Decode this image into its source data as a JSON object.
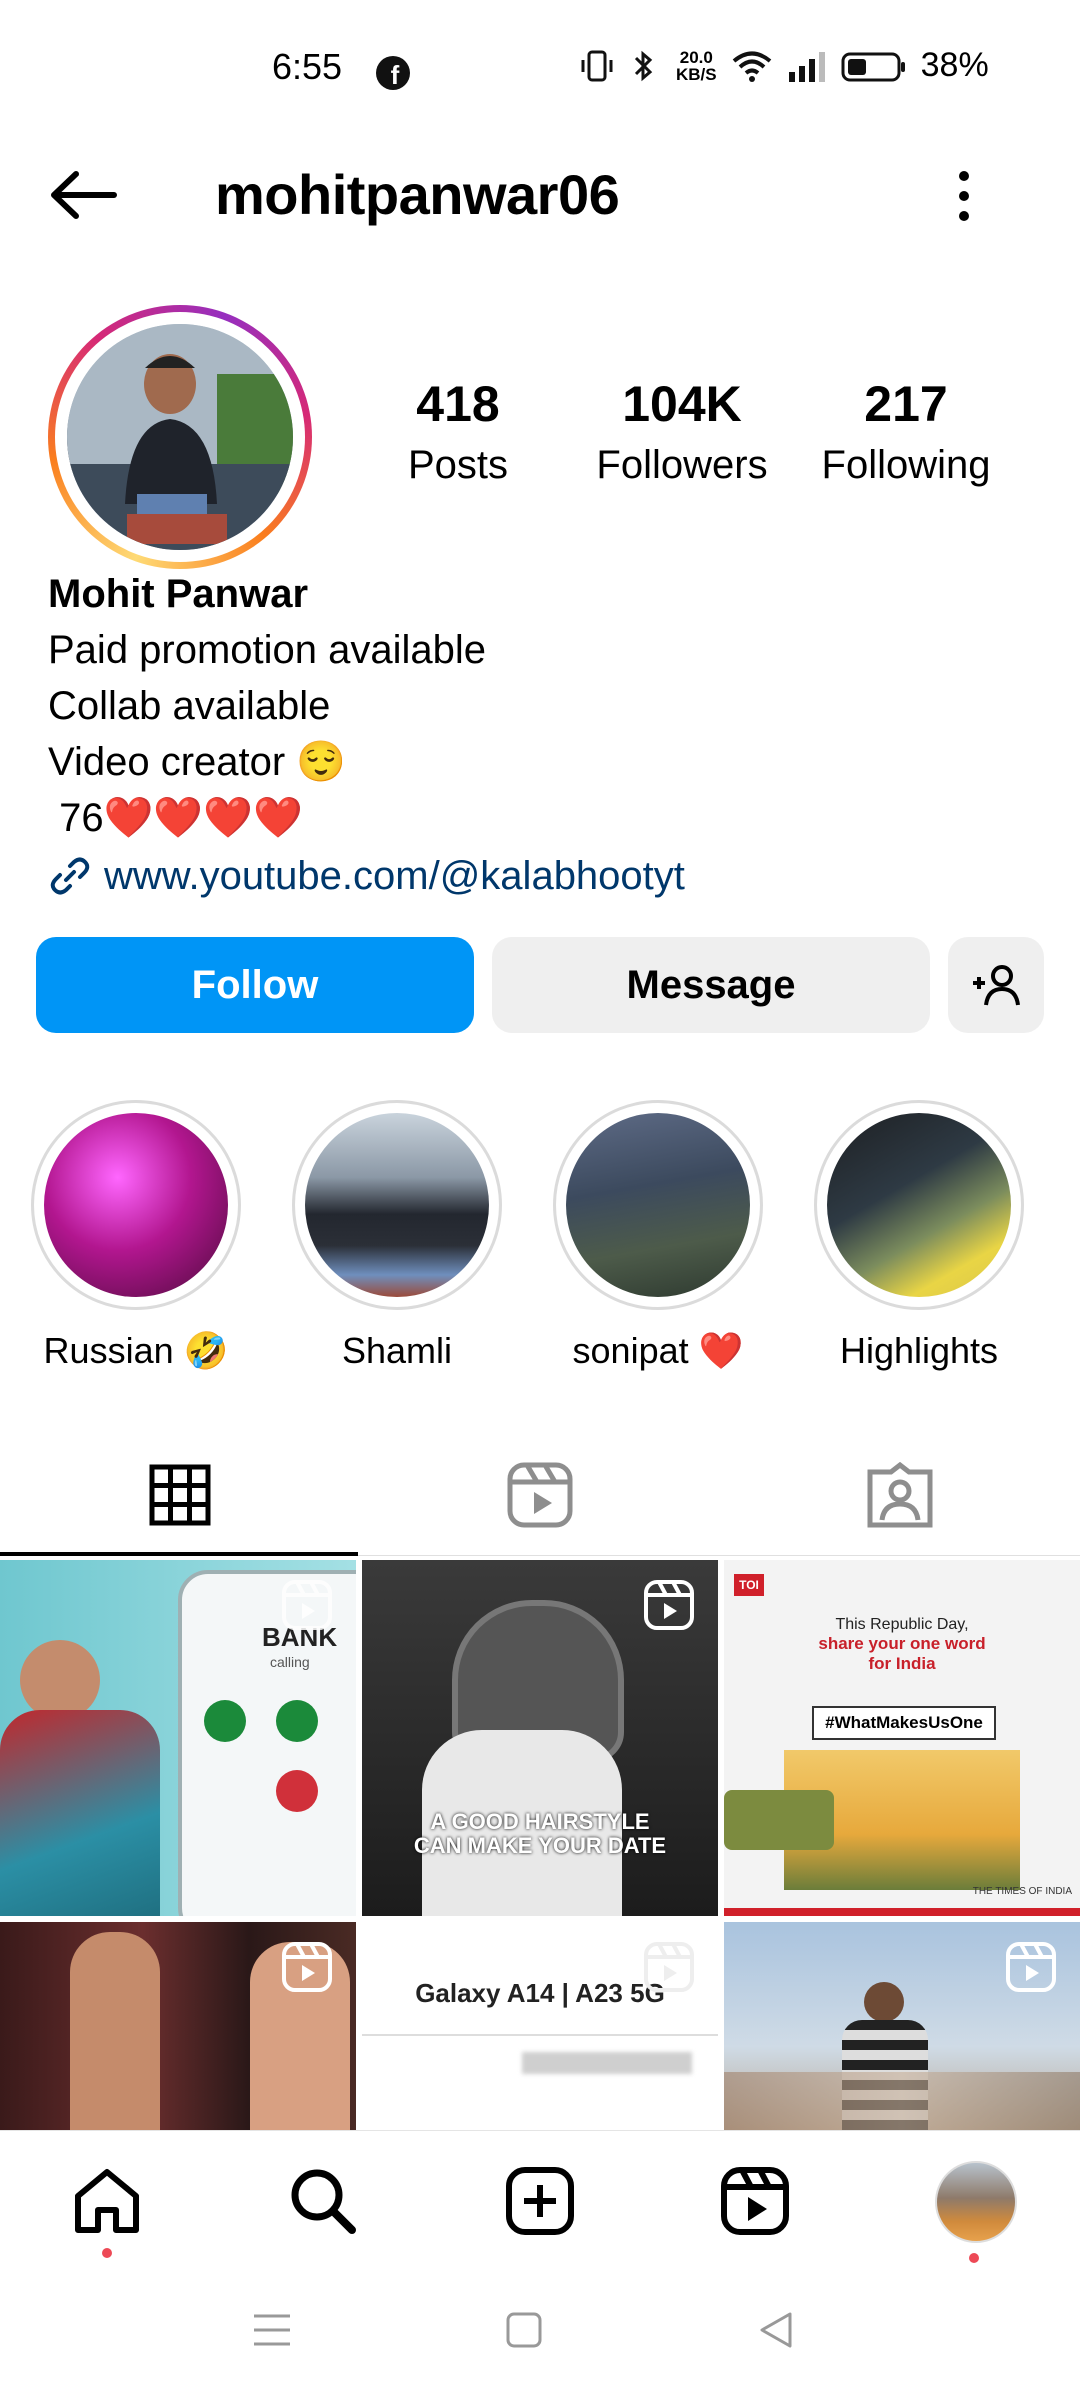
{
  "status_bar": {
    "time": "6:55",
    "speed_value": "20.0",
    "speed_unit": "KB/S",
    "battery": "38%"
  },
  "header": {
    "username": "mohitpanwar06"
  },
  "profile": {
    "stats": [
      {
        "value": "418",
        "label": "Posts"
      },
      {
        "value": "104K",
        "label": "Followers"
      },
      {
        "value": "217",
        "label": "Following"
      }
    ],
    "name": "Mohit Panwar",
    "bio_lines": [
      "Paid promotion available",
      "Collab available",
      "Video creator 😌",
      " 76❤️❤️❤️❤️"
    ],
    "link": "www.youtube.com/@kalabhootyt"
  },
  "actions": {
    "follow": "Follow",
    "message": "Message"
  },
  "highlights": [
    {
      "label": "Russian 🤣"
    },
    {
      "label": "Shamli"
    },
    {
      "label": "sonipat ❤️"
    },
    {
      "label": "Highlights"
    }
  ],
  "posts": [
    {
      "text": "BANK",
      "subtext": "calling"
    },
    {
      "text": "A GOOD HAIRSTYLE\nCAN MAKE YOUR DATE"
    },
    {
      "badge": "TOI",
      "line1": "This Republic Day,",
      "line2": "share your one word",
      "line3": "for India",
      "tag": "#WhatMakesUsOne",
      "footer": "THE TIMES OF INDIA"
    },
    {},
    {
      "text": "Galaxy A14 | A23 5G"
    },
    {}
  ],
  "colors": {
    "follow_blue": "#0095f6",
    "link_blue": "#00376b",
    "notification_red": "#ed4956"
  }
}
